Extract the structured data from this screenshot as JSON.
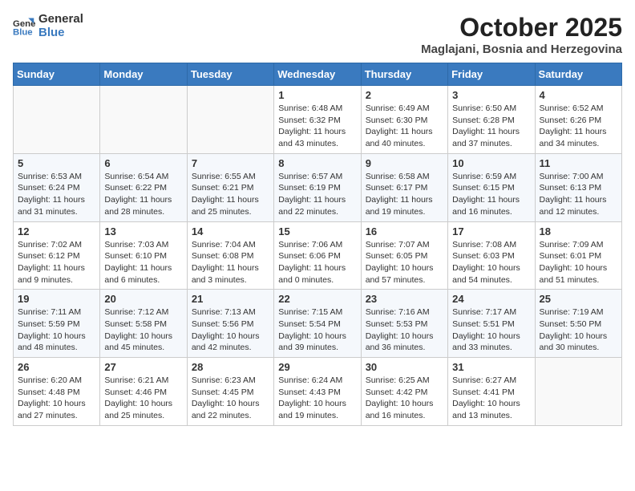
{
  "header": {
    "logo_line1": "General",
    "logo_line2": "Blue",
    "month": "October 2025",
    "location": "Maglajani, Bosnia and Herzegovina"
  },
  "weekdays": [
    "Sunday",
    "Monday",
    "Tuesday",
    "Wednesday",
    "Thursday",
    "Friday",
    "Saturday"
  ],
  "weeks": [
    [
      {
        "day": "",
        "info": ""
      },
      {
        "day": "",
        "info": ""
      },
      {
        "day": "",
        "info": ""
      },
      {
        "day": "1",
        "info": "Sunrise: 6:48 AM\nSunset: 6:32 PM\nDaylight: 11 hours\nand 43 minutes."
      },
      {
        "day": "2",
        "info": "Sunrise: 6:49 AM\nSunset: 6:30 PM\nDaylight: 11 hours\nand 40 minutes."
      },
      {
        "day": "3",
        "info": "Sunrise: 6:50 AM\nSunset: 6:28 PM\nDaylight: 11 hours\nand 37 minutes."
      },
      {
        "day": "4",
        "info": "Sunrise: 6:52 AM\nSunset: 6:26 PM\nDaylight: 11 hours\nand 34 minutes."
      }
    ],
    [
      {
        "day": "5",
        "info": "Sunrise: 6:53 AM\nSunset: 6:24 PM\nDaylight: 11 hours\nand 31 minutes."
      },
      {
        "day": "6",
        "info": "Sunrise: 6:54 AM\nSunset: 6:22 PM\nDaylight: 11 hours\nand 28 minutes."
      },
      {
        "day": "7",
        "info": "Sunrise: 6:55 AM\nSunset: 6:21 PM\nDaylight: 11 hours\nand 25 minutes."
      },
      {
        "day": "8",
        "info": "Sunrise: 6:57 AM\nSunset: 6:19 PM\nDaylight: 11 hours\nand 22 minutes."
      },
      {
        "day": "9",
        "info": "Sunrise: 6:58 AM\nSunset: 6:17 PM\nDaylight: 11 hours\nand 19 minutes."
      },
      {
        "day": "10",
        "info": "Sunrise: 6:59 AM\nSunset: 6:15 PM\nDaylight: 11 hours\nand 16 minutes."
      },
      {
        "day": "11",
        "info": "Sunrise: 7:00 AM\nSunset: 6:13 PM\nDaylight: 11 hours\nand 12 minutes."
      }
    ],
    [
      {
        "day": "12",
        "info": "Sunrise: 7:02 AM\nSunset: 6:12 PM\nDaylight: 11 hours\nand 9 minutes."
      },
      {
        "day": "13",
        "info": "Sunrise: 7:03 AM\nSunset: 6:10 PM\nDaylight: 11 hours\nand 6 minutes."
      },
      {
        "day": "14",
        "info": "Sunrise: 7:04 AM\nSunset: 6:08 PM\nDaylight: 11 hours\nand 3 minutes."
      },
      {
        "day": "15",
        "info": "Sunrise: 7:06 AM\nSunset: 6:06 PM\nDaylight: 11 hours\nand 0 minutes."
      },
      {
        "day": "16",
        "info": "Sunrise: 7:07 AM\nSunset: 6:05 PM\nDaylight: 10 hours\nand 57 minutes."
      },
      {
        "day": "17",
        "info": "Sunrise: 7:08 AM\nSunset: 6:03 PM\nDaylight: 10 hours\nand 54 minutes."
      },
      {
        "day": "18",
        "info": "Sunrise: 7:09 AM\nSunset: 6:01 PM\nDaylight: 10 hours\nand 51 minutes."
      }
    ],
    [
      {
        "day": "19",
        "info": "Sunrise: 7:11 AM\nSunset: 5:59 PM\nDaylight: 10 hours\nand 48 minutes."
      },
      {
        "day": "20",
        "info": "Sunrise: 7:12 AM\nSunset: 5:58 PM\nDaylight: 10 hours\nand 45 minutes."
      },
      {
        "day": "21",
        "info": "Sunrise: 7:13 AM\nSunset: 5:56 PM\nDaylight: 10 hours\nand 42 minutes."
      },
      {
        "day": "22",
        "info": "Sunrise: 7:15 AM\nSunset: 5:54 PM\nDaylight: 10 hours\nand 39 minutes."
      },
      {
        "day": "23",
        "info": "Sunrise: 7:16 AM\nSunset: 5:53 PM\nDaylight: 10 hours\nand 36 minutes."
      },
      {
        "day": "24",
        "info": "Sunrise: 7:17 AM\nSunset: 5:51 PM\nDaylight: 10 hours\nand 33 minutes."
      },
      {
        "day": "25",
        "info": "Sunrise: 7:19 AM\nSunset: 5:50 PM\nDaylight: 10 hours\nand 30 minutes."
      }
    ],
    [
      {
        "day": "26",
        "info": "Sunrise: 6:20 AM\nSunset: 4:48 PM\nDaylight: 10 hours\nand 27 minutes."
      },
      {
        "day": "27",
        "info": "Sunrise: 6:21 AM\nSunset: 4:46 PM\nDaylight: 10 hours\nand 25 minutes."
      },
      {
        "day": "28",
        "info": "Sunrise: 6:23 AM\nSunset: 4:45 PM\nDaylight: 10 hours\nand 22 minutes."
      },
      {
        "day": "29",
        "info": "Sunrise: 6:24 AM\nSunset: 4:43 PM\nDaylight: 10 hours\nand 19 minutes."
      },
      {
        "day": "30",
        "info": "Sunrise: 6:25 AM\nSunset: 4:42 PM\nDaylight: 10 hours\nand 16 minutes."
      },
      {
        "day": "31",
        "info": "Sunrise: 6:27 AM\nSunset: 4:41 PM\nDaylight: 10 hours\nand 13 minutes."
      },
      {
        "day": "",
        "info": ""
      }
    ]
  ]
}
